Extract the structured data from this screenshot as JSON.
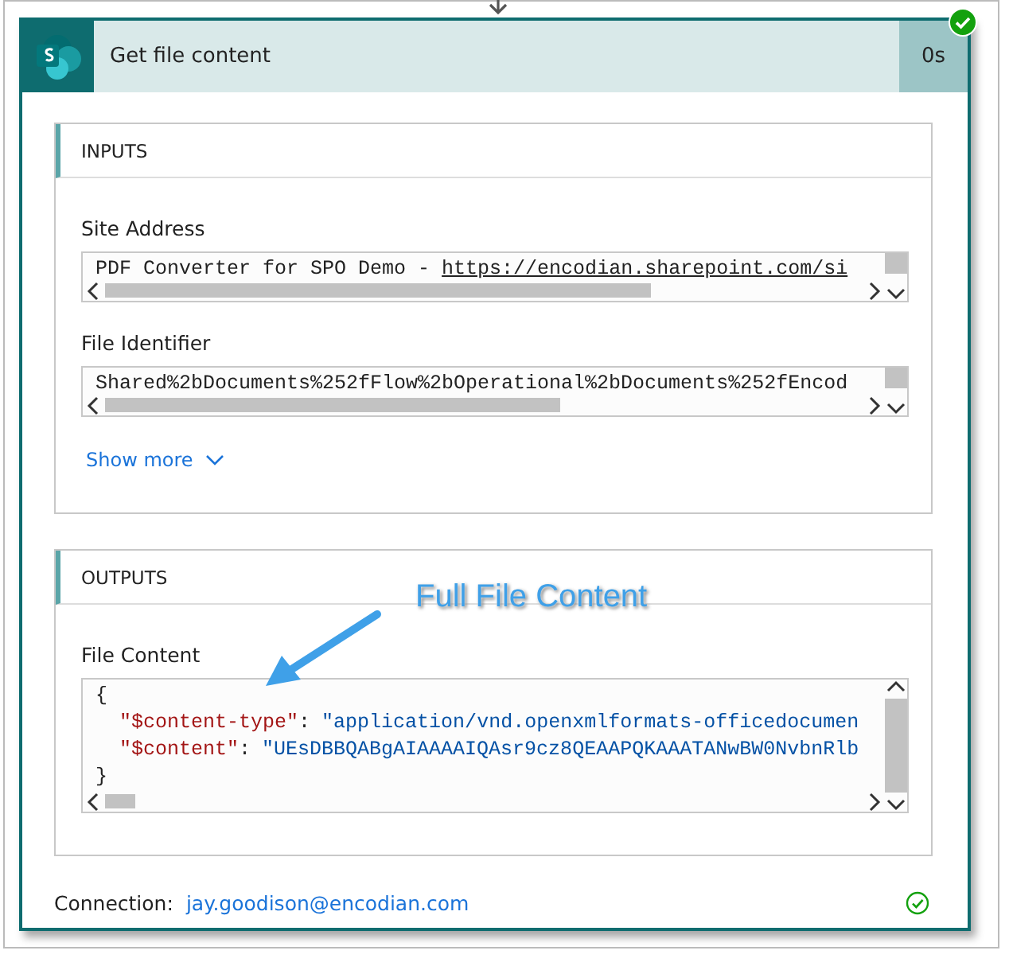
{
  "action": {
    "title": "Get file content",
    "duration": "0s",
    "succeeded": true
  },
  "inputs": {
    "heading": "INPUTS",
    "fields": [
      {
        "label": "Site Address",
        "text": "PDF Converter for SPO Demo - ",
        "link": "https://encodian.sharepoint.com/si"
      },
      {
        "label": "File Identifier",
        "text": "Shared%2bDocuments%252fFlow%2bOperational%2bDocuments%252fEncod"
      }
    ],
    "show_more": {
      "label": "Show more",
      "expanded": false
    }
  },
  "outputs": {
    "heading": "OUTPUTS",
    "annotation": "Full File Content",
    "field": {
      "label": "File Content",
      "lines": [
        {
          "kind": "brace",
          "text": "{"
        },
        {
          "kind": "pair",
          "key": "\"$content-type\"",
          "colon": ":",
          "value": "\"application/vnd.openxmlformats-officedocumen"
        },
        {
          "kind": "pair",
          "key": "\"$content\"",
          "colon": ":",
          "value": "\"UEsDBBQABgAIAAAAIQAsr9cz8QEAAPQKAAATANwBW0NvbnRlb"
        },
        {
          "kind": "brace",
          "text": "}"
        }
      ]
    }
  },
  "connection": {
    "label": "Connection:",
    "account": "jay.goodison@encodian.com",
    "valid": true
  }
}
